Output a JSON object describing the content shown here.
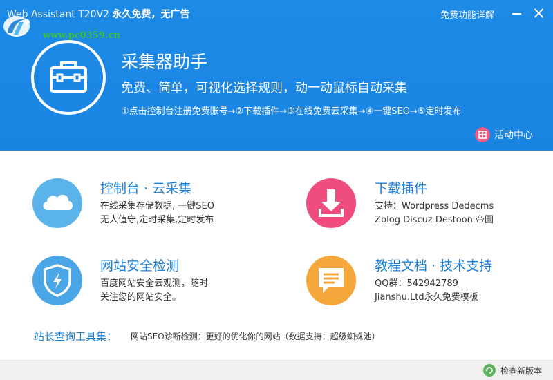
{
  "window": {
    "title_prefix": "Web Assistant T20V2",
    "title_suffix": "永久免费，无广告",
    "features_link": "免费功能详解"
  },
  "watermark": {
    "url": "www.pc0359.cn"
  },
  "hero": {
    "title": "采集器助手",
    "subtitle": "免费、简单，可视化选择规则，动一动鼠标自动采集",
    "steps": "①点击控制台注册免费账号→②下载插件→③在线免费云采集→④一键SEO→⑤定时发布",
    "activity_label": "活动中心"
  },
  "cards": [
    {
      "title": "控制台 · 云采集",
      "desc_line1": "在线采集存储数据, 一键SEO",
      "desc_line2": "无人值守,定时采集,定时发布",
      "icon": "cloud-icon"
    },
    {
      "title": "下载插件",
      "desc_line1": "支持：Wordpress Dedecms",
      "desc_line2": "Zblog Discuz Destoon 帝国",
      "icon": "download-icon"
    },
    {
      "title": "网站安全检测",
      "desc_line1": "百度网站安全云观测，随时",
      "desc_line2": "关注您的网站安全。",
      "icon": "shield-icon"
    },
    {
      "title": "教程文档 · 技术支持",
      "desc_line1": "QQ群：542942789",
      "desc_line2": "Jianshu.Ltd永久免费模板",
      "icon": "chat-icon"
    }
  ],
  "tools": {
    "label": "站长查询工具集：",
    "link": "网站SEO诊断检测：更好的优化你的网站（数据支持：超级蜘蛛池）"
  },
  "footer": {
    "update_label": "检查新版本"
  },
  "colors": {
    "header_bg": "#1d8ae6",
    "accent_text": "#1a7fd8",
    "cloud": "#5ab4ea",
    "plugin": "#ee4d7e",
    "security": "#4aa6e6",
    "docs": "#f6a73b",
    "update": "#58b35a"
  }
}
